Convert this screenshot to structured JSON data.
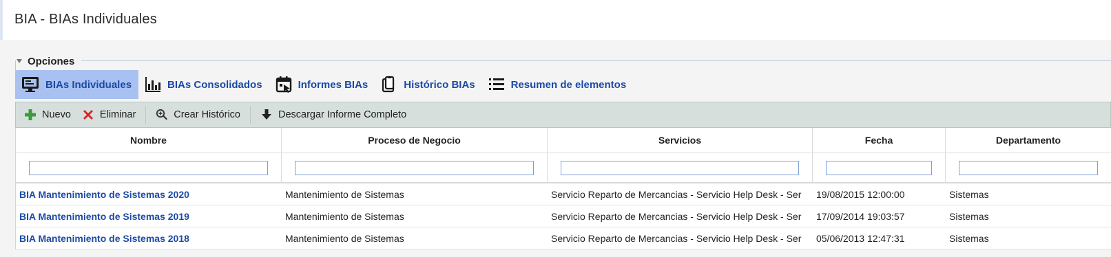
{
  "page": {
    "title": "BIA  - BIAs Individuales"
  },
  "options": {
    "label": "Opciones"
  },
  "tabs": [
    {
      "label": "BIAs Individuales",
      "icon": "monitor-icon",
      "active": true
    },
    {
      "label": "BIAs Consolidados",
      "icon": "bar-chart-icon",
      "active": false
    },
    {
      "label": "Informes BIAs",
      "icon": "calendar-icon",
      "active": false
    },
    {
      "label": "Histórico BIAs",
      "icon": "clipboard-icon",
      "active": false
    },
    {
      "label": "Resumen de elementos",
      "icon": "list-icon",
      "active": false
    }
  ],
  "toolbar": {
    "nuevo": "Nuevo",
    "eliminar": "Eliminar",
    "crear_historico": "Crear Histórico",
    "descargar": "Descargar Informe Completo"
  },
  "table": {
    "columns": [
      "Nombre",
      "Proceso de Negocio",
      "Servicios",
      "Fecha",
      "Departamento"
    ],
    "rows": [
      [
        "BIA Mantenimiento de Sistemas 2020",
        "Mantenimiento de Sistemas",
        "Servicio Reparto de Mercancias - Servicio Help Desk - Ser",
        "19/08/2015 12:00:00",
        "Sistemas"
      ],
      [
        "BIA Mantenimiento de Sistemas 2019",
        "Mantenimiento de Sistemas",
        "Servicio Reparto de Mercancias - Servicio Help Desk - Ser",
        "17/09/2014 19:03:57",
        "Sistemas"
      ],
      [
        "BIA Mantenimiento de Sistemas 2018",
        "Mantenimiento de Sistemas",
        "Servicio Reparto de Mercancias - Servicio Help Desk - Ser",
        "05/06/2013 12:47:31",
        "Sistemas"
      ]
    ]
  },
  "colors": {
    "link": "#1b4aa6",
    "active_tab": "#a9c1f1",
    "toolbar": "#d6dfdc",
    "add": "#3a9d3a",
    "delete": "#e02020"
  }
}
